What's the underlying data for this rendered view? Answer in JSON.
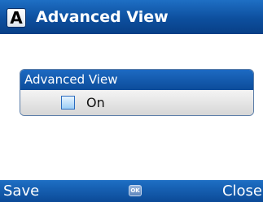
{
  "header": {
    "icon_letter": "A",
    "icon_name": "app-letter-icon",
    "title": "Advanced View"
  },
  "group": {
    "label": "Advanced View",
    "option_label": "On",
    "checked": false
  },
  "softkeys": {
    "left_label": "Save",
    "center_label": "OK",
    "center_icon_name": "ok-key-icon",
    "right_label": "Close"
  },
  "colors": {
    "bar_blue": "#0d4f9e",
    "body_bg": "#ffffff",
    "row_gray": "#e0e0e0"
  }
}
